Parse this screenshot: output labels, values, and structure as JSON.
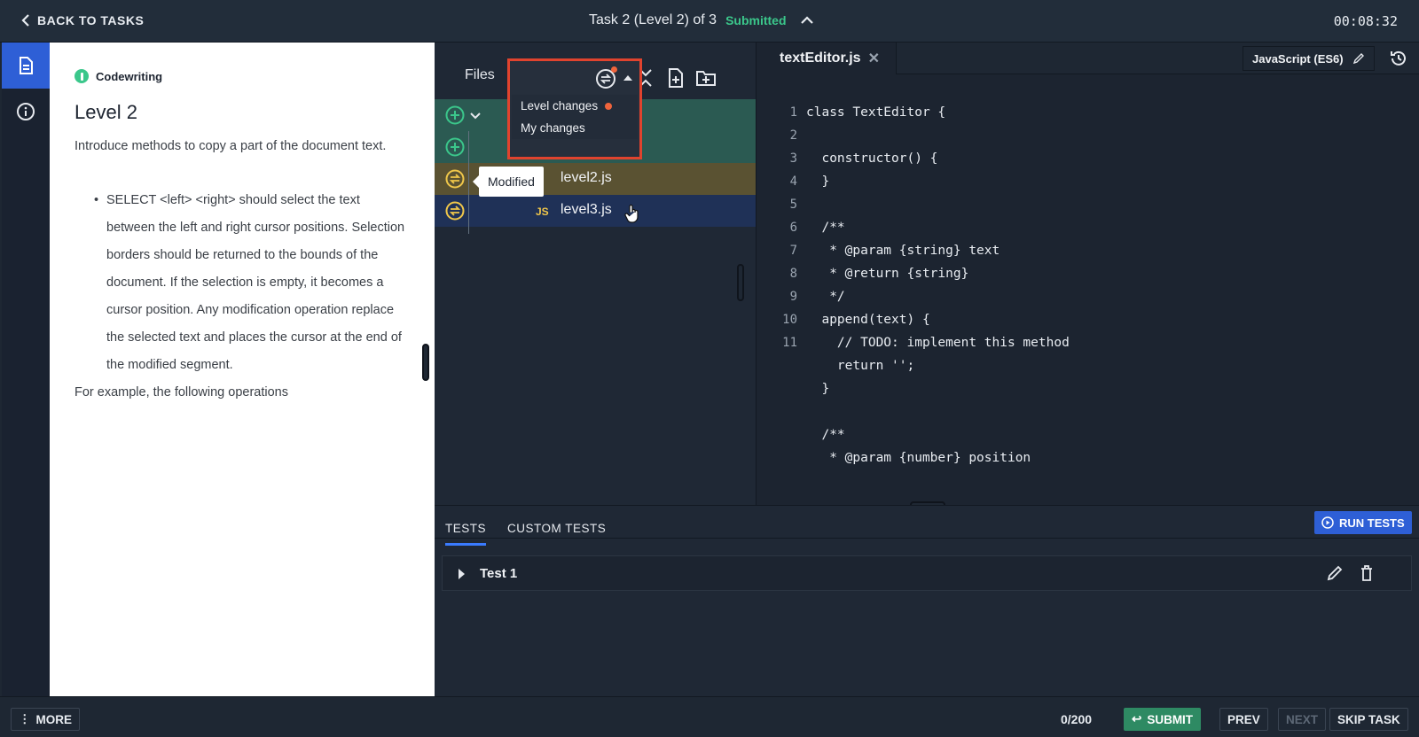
{
  "topbar": {
    "back_label": "BACK TO TASKS",
    "task_title": "Task 2 (Level 2) of 3",
    "status": "Submitted",
    "timer": "00:08:32"
  },
  "description": {
    "kind": "Codewriting",
    "heading": "Level 2",
    "intro": "Introduce methods to copy a part of the document text.",
    "bullets": [
      "SELECT <left> <right> should select the text between the left and right cursor positions. Selection borders should be returned to the bounds of the document. If the selection is empty, it becomes a cursor position. Any modification operation replace the selected text and places the cursor at the end of the modified segment."
    ],
    "outro": "For example, the following operations"
  },
  "files": {
    "title": "Files",
    "menu": [
      "Level changes",
      "My changes"
    ],
    "tooltip": "Modified",
    "items": [
      {
        "name": "level2.js",
        "badge": ""
      },
      {
        "name": "level3.js",
        "badge": "JS"
      }
    ]
  },
  "editor": {
    "tab": "textEditor.js",
    "language": "JavaScript (ES6)",
    "line_numbers": [
      "1",
      "2",
      "3",
      "4",
      "5",
      "6",
      "7",
      "8",
      "9",
      "10",
      "11"
    ],
    "code_lines": [
      "class TextEditor {",
      "",
      "  constructor() {",
      "  }",
      "",
      "  /**",
      "   * @param {string} text",
      "   * @return {string}",
      "   */",
      "  append(text) {",
      "    // TODO: implement this method",
      "    return '';",
      "  }",
      "",
      "  /**",
      "   * @param {number} position"
    ]
  },
  "tests": {
    "tabs": [
      "TESTS",
      "CUSTOM TESTS"
    ],
    "run_label": "RUN TESTS",
    "items": [
      {
        "name": "Test 1"
      }
    ]
  },
  "footer": {
    "more_label": "MORE",
    "score": "0/200",
    "submit_label": "SUBMIT",
    "prev_label": "PREV",
    "next_label": "NEXT",
    "skip_label": "SKIP TASK"
  },
  "colors": {
    "accent": "#2e5fd6",
    "submitted": "#3bc78b",
    "highlight_box": "#e0432e",
    "submit_button": "#2e8a63"
  }
}
